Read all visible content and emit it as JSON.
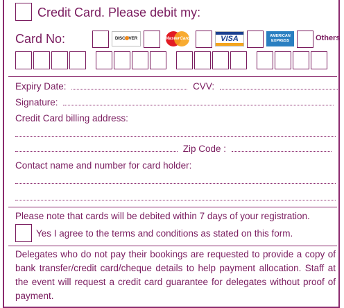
{
  "header": {
    "title": "Credit Card. Please debit my:"
  },
  "card": {
    "label": "Card No:",
    "brands": [
      {
        "icon": "discover-logo",
        "text": "DISCOVER"
      },
      {
        "icon": "mastercard-logo",
        "text": "MasterCard"
      },
      {
        "icon": "visa-logo",
        "text": "VISA"
      },
      {
        "icon": "amex-logo",
        "text": "AMERICAN EXPRESS"
      }
    ],
    "others_label": "Others",
    "digit_groups": 4,
    "digits_per_group": 4
  },
  "fields": {
    "expiry_label": "Expiry Date:",
    "cvv_label": "CVV:",
    "signature_label": "Signature:",
    "billing_label": "Credit Card billing address:",
    "zip_label": "Zip Code :",
    "contact_label": "Contact name and number for card holder:"
  },
  "notes": {
    "debit_note": "Please note that cards will be debited within 7 days of your registration.",
    "agree_label": "Yes I agree to the terms and conditions as stated on this form.",
    "delegates_note": "Delegates who do not pay their bookings are requested to provide a copy of bank transfer/credit card/cheque details to help payment allocation. Staff at the event will request a credit card guarantee for delegates without proof of payment."
  },
  "colors": {
    "accent": "#7a1c5f",
    "border": "#8b2a6e"
  }
}
